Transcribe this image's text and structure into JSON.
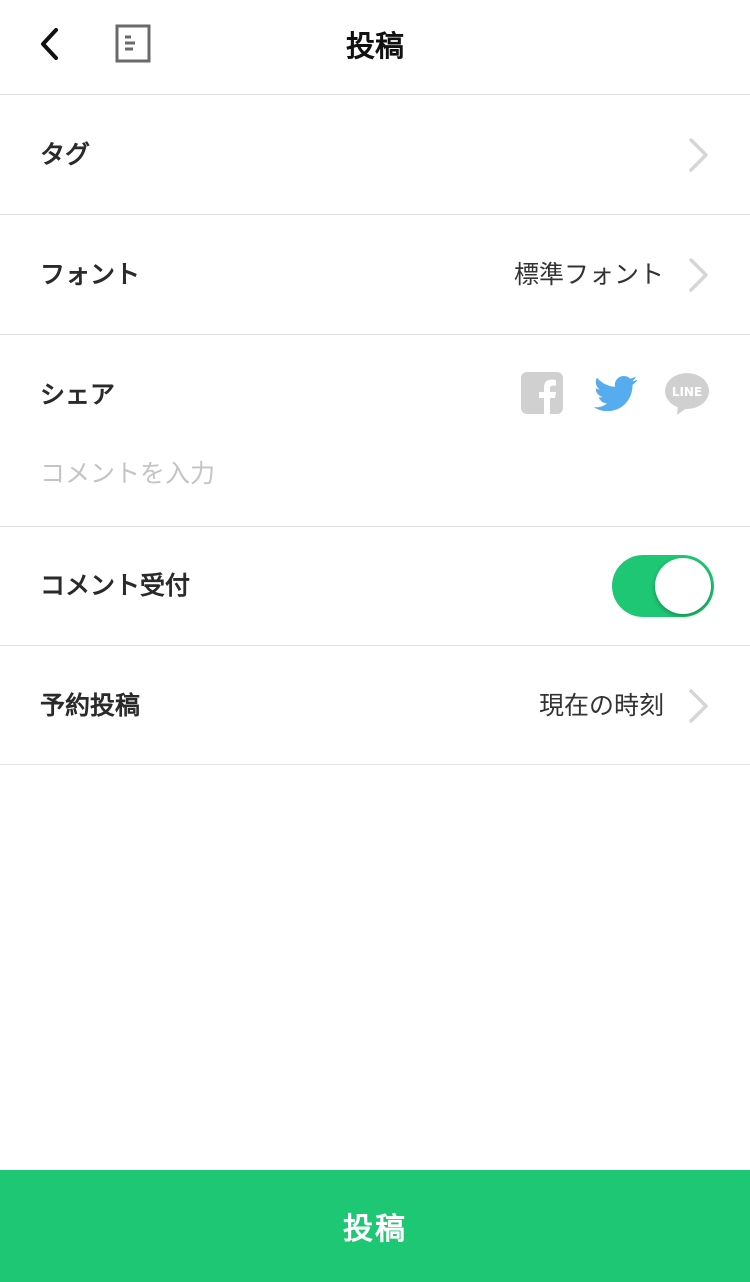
{
  "header": {
    "title": "投稿",
    "back_icon": "chevron-left-icon",
    "doc_icon": "document-icon"
  },
  "rows": {
    "tag": {
      "label": "タグ"
    },
    "font": {
      "label": "フォント",
      "value": "標準フォント"
    },
    "share": {
      "label": "シェア",
      "comment_placeholder": "コメントを入力",
      "comment_value": "",
      "services": [
        "facebook",
        "twitter",
        "line"
      ],
      "line_text": "LINE"
    },
    "comment": {
      "label": "コメント受付",
      "enabled": true
    },
    "schedule": {
      "label": "予約投稿",
      "value": "現在の時刻"
    }
  },
  "footer": {
    "post_label": "投稿"
  },
  "colors": {
    "accent": "#1ec773",
    "twitter": "#55acee",
    "icon_gray": "#d0d0d0",
    "chevron": "#d6d6d6",
    "divider": "#e2e2e2"
  }
}
